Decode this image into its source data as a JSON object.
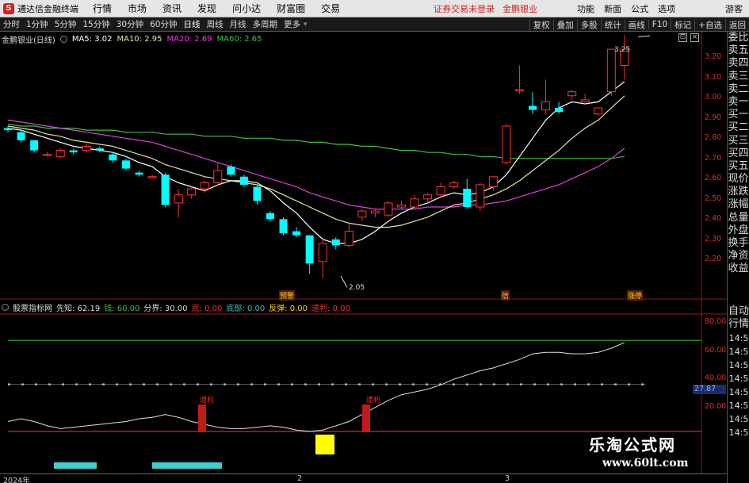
{
  "titlebar": {
    "logo": "S",
    "app_title": "通达信金融终端",
    "menus": [
      "行情",
      "市场",
      "资讯",
      "发现",
      "问小达",
      "财富圈",
      "交易"
    ],
    "login_status": "证券交易未登录",
    "stock_name": "金鹏银业",
    "buttons": [
      "功能",
      "新面",
      "公式",
      "选项"
    ],
    "guest": "游客"
  },
  "periods": [
    "分时",
    "1分钟",
    "5分钟",
    "15分钟",
    "30分钟",
    "60分钟",
    "日线",
    "周线",
    "月线",
    "多周期",
    "更多"
  ],
  "period_active": "日线",
  "tools": [
    "复权",
    "叠加",
    "多股",
    "统计",
    "画线",
    "F10",
    "标记",
    "+自选",
    "返回"
  ],
  "legend": {
    "stock": "金鹏银业(日线)",
    "ma5": "MA5: 3.02",
    "ma10": "MA10: 2.95",
    "ma20": "MA20: 2.69",
    "ma60": "MA60: 2.65"
  },
  "sidebar": [
    "委比",
    "卖五",
    "卖四",
    "卖三",
    "卖二",
    "卖一",
    "买一",
    "买二",
    "买三",
    "买四",
    "买五",
    "现价",
    "涨跌",
    "涨幅",
    "总量",
    "外盘",
    "换手",
    "净资",
    "收益"
  ],
  "sidebar_low": [
    "自动",
    "行情",
    "14:5",
    "14:5",
    "14:5",
    "14:5",
    "14:5",
    "14:5",
    "14:5",
    "14:5"
  ],
  "price_ticks": [
    "3.20",
    "3.10",
    "3.00",
    "2.90",
    "2.80",
    "2.70",
    "2.60",
    "2.50",
    "2.40",
    "2.30",
    "2.20"
  ],
  "annotations": {
    "high": "3.25",
    "low": "2.05"
  },
  "signals": [
    "预警",
    "信",
    "涨停"
  ],
  "indicator": {
    "name": "股票指标网",
    "xianzhi": "先知: 62.19",
    "qian": "钱: 60.00",
    "fenjie": "分界: 30.00",
    "di": "底: 0.00",
    "dibu": "底部: 0.00",
    "fantan": "反弹: 0.00",
    "lirun": "逮利: 0.00",
    "ticks": [
      "80.00",
      "60.00",
      "40.00",
      "20.00"
    ],
    "marker": "逮利",
    "time_value": "27.87"
  },
  "dates": [
    "2024年",
    "2",
    "3"
  ],
  "watermark": {
    "cn": "乐淘公式网",
    "url": "www.60lt.com"
  },
  "colors": {
    "up": "#ff3232",
    "down": "#00ffff",
    "ma5": "#ffffff",
    "ma10": "#e8e0a0",
    "ma20": "#e040e0",
    "ma60": "#3fbf3f"
  },
  "chart_data": {
    "type": "candlestick",
    "ohlc": [
      [
        2.79,
        2.8,
        2.77,
        2.78
      ],
      [
        2.77,
        2.78,
        2.72,
        2.73
      ],
      [
        2.73,
        2.73,
        2.67,
        2.68
      ],
      [
        2.66,
        2.67,
        2.65,
        2.66
      ],
      [
        2.65,
        2.69,
        2.64,
        2.68
      ],
      [
        2.68,
        2.69,
        2.66,
        2.67
      ],
      [
        2.68,
        2.71,
        2.67,
        2.7
      ],
      [
        2.69,
        2.7,
        2.67,
        2.68
      ],
      [
        2.66,
        2.67,
        2.62,
        2.63
      ],
      [
        2.63,
        2.64,
        2.58,
        2.59
      ],
      [
        2.57,
        2.58,
        2.55,
        2.56
      ],
      [
        2.55,
        2.56,
        2.54,
        2.55
      ],
      [
        2.56,
        2.57,
        2.4,
        2.41
      ],
      [
        2.42,
        2.49,
        2.35,
        2.46
      ],
      [
        2.46,
        2.5,
        2.44,
        2.49
      ],
      [
        2.49,
        2.53,
        2.47,
        2.52
      ],
      [
        2.52,
        2.62,
        2.5,
        2.58
      ],
      [
        2.6,
        2.61,
        2.55,
        2.56
      ],
      [
        2.55,
        2.56,
        2.5,
        2.51
      ],
      [
        2.5,
        2.51,
        2.41,
        2.43
      ],
      [
        2.37,
        2.38,
        2.33,
        2.34
      ],
      [
        2.34,
        2.35,
        2.26,
        2.27
      ],
      [
        2.28,
        2.3,
        2.25,
        2.26
      ],
      [
        2.26,
        2.26,
        2.07,
        2.12
      ],
      [
        2.13,
        2.25,
        2.05,
        2.22
      ],
      [
        2.24,
        2.25,
        2.19,
        2.21
      ],
      [
        2.21,
        2.32,
        2.2,
        2.28
      ],
      [
        2.35,
        2.39,
        2.33,
        2.38
      ],
      [
        2.37,
        2.39,
        2.35,
        2.38
      ],
      [
        2.36,
        2.43,
        2.35,
        2.42
      ],
      [
        2.4,
        2.43,
        2.39,
        2.41
      ],
      [
        2.4,
        2.46,
        2.39,
        2.44
      ],
      [
        2.44,
        2.47,
        2.42,
        2.46
      ],
      [
        2.46,
        2.52,
        2.45,
        2.5
      ],
      [
        2.5,
        2.53,
        2.49,
        2.52
      ],
      [
        2.49,
        2.54,
        2.39,
        2.4
      ],
      [
        2.4,
        2.52,
        2.38,
        2.51
      ],
      [
        2.5,
        2.55,
        2.48,
        2.55
      ],
      [
        2.62,
        2.81,
        2.61,
        2.8
      ],
      [
        2.98,
        3.1,
        2.96,
        2.98
      ],
      [
        2.9,
        2.97,
        2.86,
        2.88
      ],
      [
        2.88,
        3.03,
        2.86,
        2.92
      ],
      [
        2.89,
        2.92,
        2.86,
        2.87
      ],
      [
        2.95,
        2.98,
        2.93,
        2.97
      ],
      [
        2.92,
        2.96,
        2.91,
        2.93
      ],
      [
        2.86,
        2.89,
        2.85,
        2.89
      ],
      [
        2.97,
        3.18,
        2.95,
        3.18
      ],
      [
        3.1,
        3.25,
        3.03,
        3.18
      ]
    ],
    "ma5": [
      2.79,
      2.78,
      2.76,
      2.74,
      2.72,
      2.7,
      2.69,
      2.68,
      2.67,
      2.65,
      2.62,
      2.6,
      2.55,
      2.52,
      2.5,
      2.48,
      2.51,
      2.53,
      2.53,
      2.52,
      2.48,
      2.42,
      2.37,
      2.3,
      2.24,
      2.22,
      2.22,
      2.24,
      2.28,
      2.33,
      2.37,
      2.4,
      2.42,
      2.45,
      2.47,
      2.46,
      2.47,
      2.5,
      2.56,
      2.65,
      2.74,
      2.83,
      2.89,
      2.92,
      2.91,
      2.92,
      2.97,
      3.02
    ],
    "ma10": [
      2.8,
      2.79,
      2.78,
      2.76,
      2.75,
      2.73,
      2.72,
      2.71,
      2.7,
      2.68,
      2.66,
      2.64,
      2.61,
      2.59,
      2.57,
      2.55,
      2.54,
      2.53,
      2.52,
      2.51,
      2.49,
      2.46,
      2.43,
      2.4,
      2.37,
      2.34,
      2.32,
      2.31,
      2.3,
      2.3,
      2.31,
      2.33,
      2.35,
      2.38,
      2.41,
      2.42,
      2.44,
      2.46,
      2.49,
      2.53,
      2.58,
      2.63,
      2.68,
      2.74,
      2.79,
      2.83,
      2.89,
      2.95
    ],
    "ma20": [
      2.83,
      2.82,
      2.81,
      2.8,
      2.79,
      2.78,
      2.77,
      2.76,
      2.75,
      2.74,
      2.73,
      2.72,
      2.7,
      2.68,
      2.66,
      2.64,
      2.62,
      2.6,
      2.58,
      2.56,
      2.54,
      2.52,
      2.5,
      2.47,
      2.45,
      2.43,
      2.41,
      2.4,
      2.39,
      2.39,
      2.39,
      2.39,
      2.4,
      2.4,
      2.4,
      2.41,
      2.41,
      2.42,
      2.43,
      2.45,
      2.47,
      2.49,
      2.51,
      2.54,
      2.57,
      2.6,
      2.64,
      2.69
    ],
    "ma60": [
      2.81,
      2.8,
      2.8,
      2.79,
      2.79,
      2.79,
      2.78,
      2.78,
      2.78,
      2.77,
      2.77,
      2.77,
      2.76,
      2.76,
      2.76,
      2.75,
      2.75,
      2.75,
      2.74,
      2.74,
      2.74,
      2.73,
      2.73,
      2.72,
      2.72,
      2.71,
      2.71,
      2.7,
      2.7,
      2.69,
      2.68,
      2.68,
      2.67,
      2.67,
      2.66,
      2.66,
      2.65,
      2.65,
      2.64,
      2.64,
      2.64,
      2.64,
      2.64,
      2.64,
      2.64,
      2.64,
      2.64,
      2.65
    ],
    "indicator_line": [
      7,
      9,
      7,
      4,
      2,
      3,
      4,
      5,
      6,
      7,
      9,
      10,
      12,
      10,
      7,
      5,
      3,
      2,
      2,
      3,
      4,
      3,
      1,
      0,
      1,
      4,
      7,
      12,
      17,
      22,
      26,
      28,
      30,
      33,
      37,
      40,
      43,
      45,
      48,
      51,
      55,
      56,
      56,
      55,
      55,
      56,
      59,
      63
    ],
    "ylim": [
      2.05,
      3.25
    ]
  }
}
